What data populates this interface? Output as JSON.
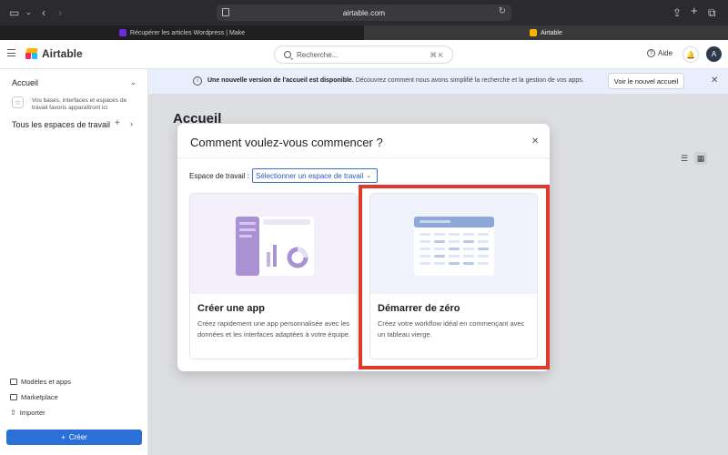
{
  "browser": {
    "url": "airtable.com",
    "tabs": [
      {
        "label": "Récupérer les articles Wordpress | Make",
        "active": false,
        "favicon_color": "#6d2bd9"
      },
      {
        "label": "Airtable",
        "active": true,
        "favicon_color": "#fcb400"
      }
    ]
  },
  "header": {
    "logo": "Airtable",
    "search_placeholder": "Recherche...",
    "search_shortcut": "⌘ K",
    "help": "Aide",
    "bell_icon": "🔔",
    "avatar_initial": "A"
  },
  "sidebar": {
    "home": "Accueil",
    "starred_hint": "Vos bases, interfaces et espaces de travail favoris apparaîtront ici",
    "workspaces": "Tous les espaces de travail",
    "bottom_items": [
      "Modèles et apps",
      "Marketplace",
      "Importer"
    ],
    "create_button": "Créer"
  },
  "banner": {
    "bold_text": "Une nouvelle version de l'accueil est disponible.",
    "text": "Découvrez comment nous avons simplifié la recherche et la gestion de vos apps.",
    "button": "Voir le nouvel accueil"
  },
  "main": {
    "title": "Accueil"
  },
  "modal": {
    "title": "Comment voulez-vous commencer ?",
    "workspace_label": "Espace de travail :",
    "workspace_select": "Sélectionner un espace de travail",
    "options": [
      {
        "title": "Créer une app",
        "description": "Créez rapidement une app personnalisée avec les données et les interfaces adaptées à votre équipe."
      },
      {
        "title": "Démarrer de zéro",
        "description": "Créez votre workflow idéal en commençant avec un tableau vierge."
      }
    ]
  },
  "colors": {
    "accent": "#2d6fd8",
    "highlight": "#e03a2b",
    "app_illus": "#a991d4",
    "scratch_illus": "#8fa8da"
  }
}
